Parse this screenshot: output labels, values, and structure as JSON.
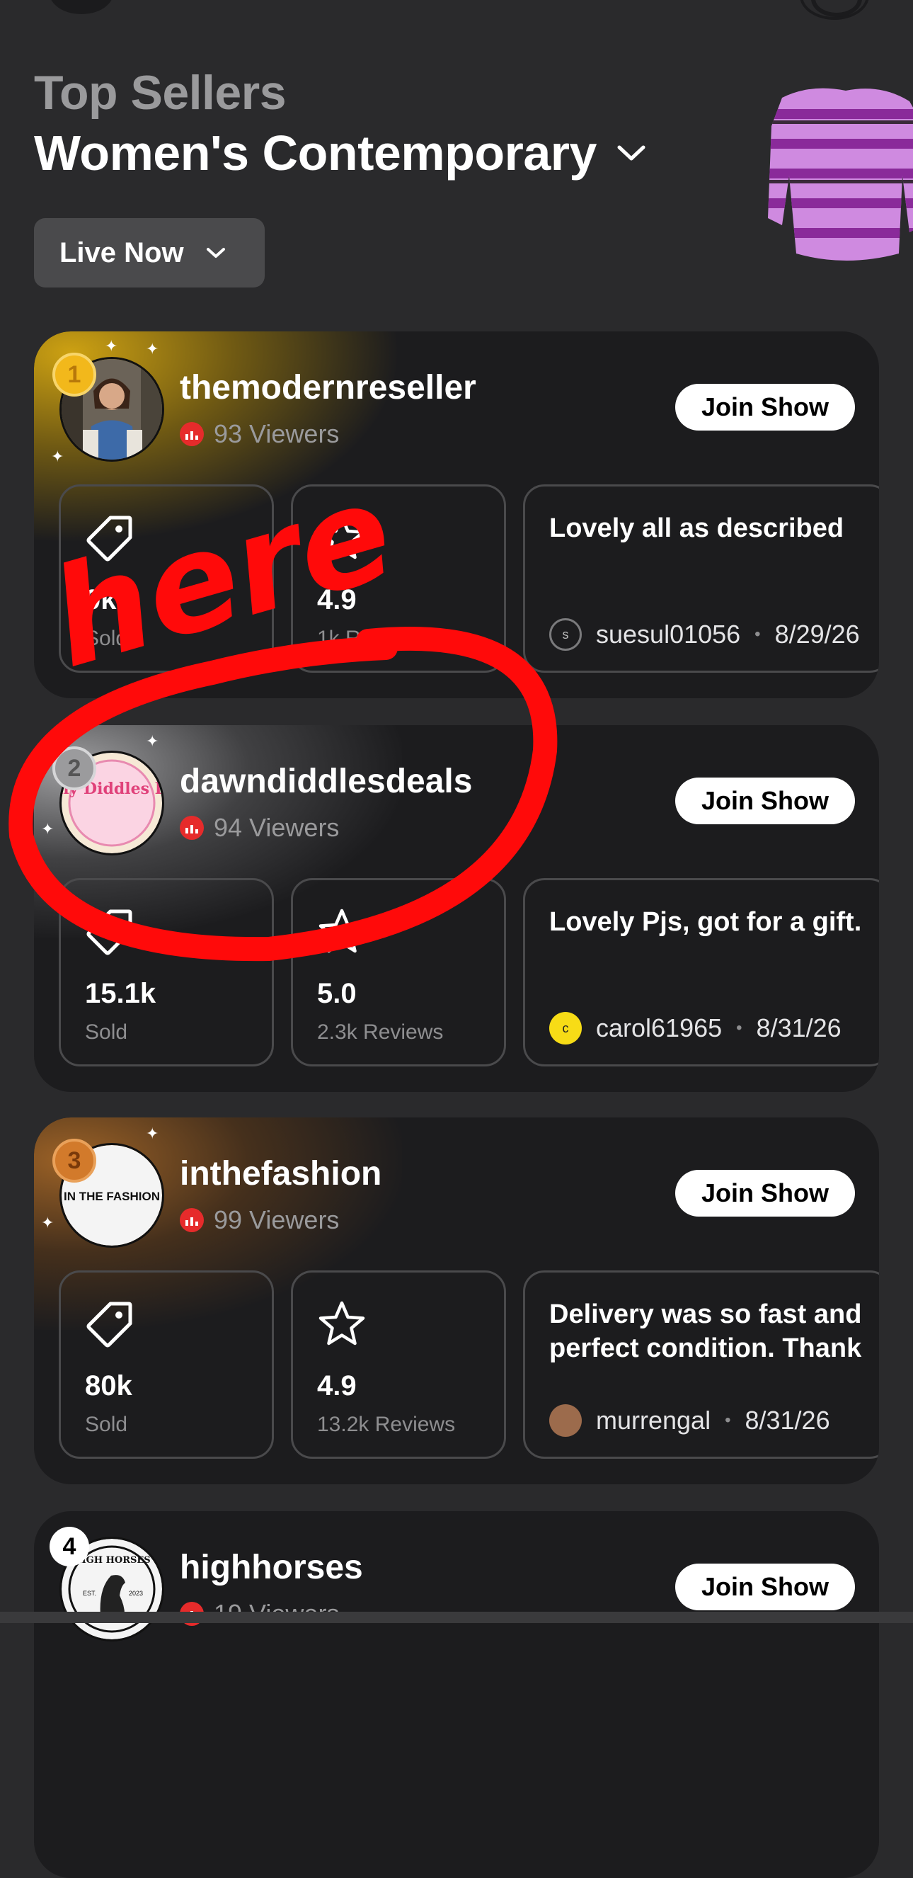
{
  "header": {
    "subtitle": "Top Sellers",
    "category": "Women's Contemporary"
  },
  "filter": {
    "label": "Live Now"
  },
  "join_label": "Join Show",
  "sellers": [
    {
      "rank": "1",
      "name": "themodernreseller",
      "viewers": "93 Viewers",
      "sold_value": "9k",
      "sold_label": "Sold",
      "rating_value": "4.9",
      "rating_label": "1k Reviews",
      "review_text": "Lovely all as described",
      "review_author": "suesul01056",
      "review_author_initial": "s",
      "review_date": "8/29/26"
    },
    {
      "rank": "2",
      "name": "dawndiddlesdeals",
      "viewers": "94 Viewers",
      "sold_value": "15.1k",
      "sold_label": "Sold",
      "rating_value": "5.0",
      "rating_label": "2.3k Reviews",
      "review_text": "Lovely Pjs, got for a gift.",
      "review_author": "carol61965",
      "review_author_initial": "c",
      "review_date": "8/31/26"
    },
    {
      "rank": "3",
      "name": "inthefashion",
      "viewers": "99 Viewers",
      "sold_value": "80k",
      "sold_label": "Sold",
      "rating_value": "4.9",
      "rating_label": "13.2k Reviews",
      "review_text": "Delivery was so fast and perfect condition. Thank",
      "review_author": "murrengal",
      "review_date": "8/31/26"
    },
    {
      "rank": "4",
      "name": "highhorses",
      "viewers": "19 Viewers"
    }
  ],
  "logos": {
    "dawn": "Dawny Diddles Deals",
    "fashion": "IN THE FASHION",
    "horses_top": "HIGH HORSES",
    "horses_est": "EST.",
    "horses_year": "2023"
  },
  "annotation": {
    "handwritten_text": "here",
    "color": "#ff0a0a"
  },
  "colors": {
    "background": "#2a2a2c",
    "card": "#1c1c1e",
    "live": "#e62b2b",
    "gold": "#f2b81b"
  }
}
